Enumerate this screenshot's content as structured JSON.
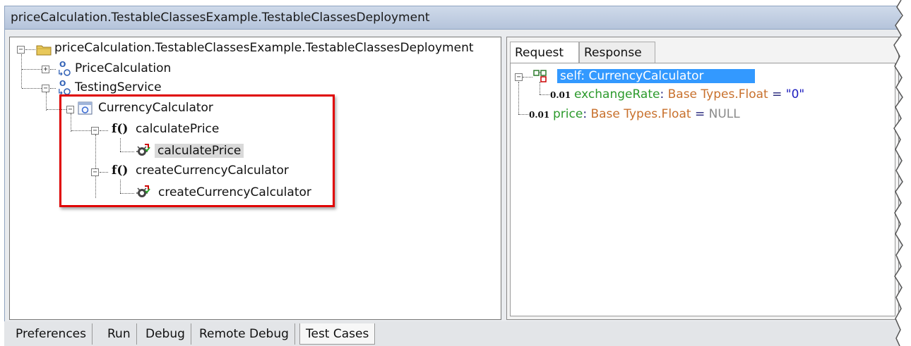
{
  "window": {
    "title": "priceCalculation.TestableClassesExample.TestableClassesDeployment"
  },
  "tree": {
    "root_label": "priceCalculation.TestableClassesExample.TestableClassesDeployment",
    "items": [
      {
        "label": "PriceCalculation"
      },
      {
        "label": "TestingService"
      },
      {
        "label": "CurrencyCalculator"
      },
      {
        "label": "calculatePrice"
      },
      {
        "label": "calculatePrice"
      },
      {
        "label": "createCurrencyCalculator"
      },
      {
        "label": "createCurrencyCalculator"
      }
    ]
  },
  "right_panel": {
    "tabs": [
      "Request",
      "Response"
    ],
    "rows": [
      {
        "text": "self: CurrencyCalculator"
      },
      {
        "prefix": "0.01",
        "name": "exchangeRate",
        "colon": ":",
        "type": "Base Types.Float",
        "eq": "=",
        "value": "\"0\""
      },
      {
        "prefix": "0.01",
        "name": "price",
        "colon": ":",
        "type": "Base Types.Float",
        "eq": "=",
        "value": "NULL"
      }
    ]
  },
  "bottom_tabs": [
    "Preferences",
    "Run",
    "Debug",
    "Remote Debug",
    "Test Cases"
  ],
  "icons": {
    "expander_minus": "−",
    "expander_plus": "+",
    "function_icon": "f()"
  },
  "colors": {
    "highlight_box": "#e00000",
    "selection_blue": "#3399ff"
  }
}
